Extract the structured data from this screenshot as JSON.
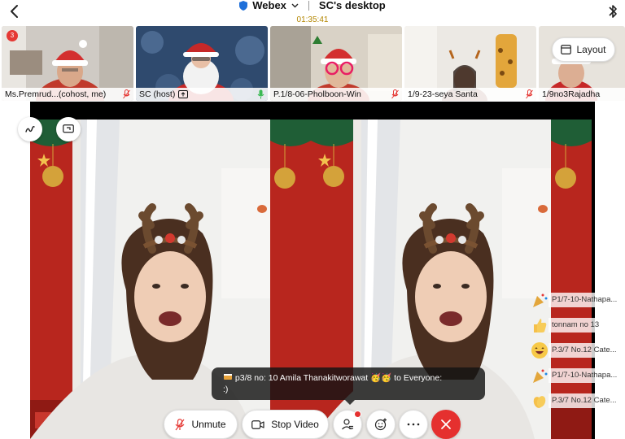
{
  "header": {
    "app_name": "Webex",
    "meeting_title": "SC's desktop",
    "timer": "01:35:41"
  },
  "participants": [
    {
      "name": "Ms.Premrud...(cohost, me)",
      "mic": "muted",
      "badge": "3"
    },
    {
      "name": "SC (host)",
      "mic": "active",
      "sharing": true
    },
    {
      "name": "P.1/8-06-Pholboon-Win",
      "mic": "muted"
    },
    {
      "name": "1/9-23-seya Santa",
      "mic": "muted"
    },
    {
      "name": "1/9no3Rajadha",
      "mic": "none"
    }
  ],
  "layout_button": {
    "label": "Layout",
    "icon": "layout-icon"
  },
  "reactions": [
    {
      "emoji": "party-popper-icon",
      "text": "P1/7-10-Nathapa..."
    },
    {
      "emoji": "thumbs-up-icon",
      "text": "tonnam no 13"
    },
    {
      "emoji": "laughing-face-icon",
      "text": "P.3/7 No.12 Cate..."
    },
    {
      "emoji": "party-popper-icon",
      "text": "P1/7-10-Nathapa..."
    },
    {
      "emoji": "clapping-hands-icon",
      "text": "P.3/7 No.12 Cate..."
    }
  ],
  "chat_toast": {
    "icon": "chat-emoji-icon",
    "sender_line": "p3/8 no: 10 Amila Thanakitworawat",
    "emojis": "🥳🥳",
    "recipient": "to Everyone:",
    "message": ":)"
  },
  "controls": {
    "unmute_label": "Unmute",
    "stop_video_label": "Stop Video",
    "participants_icon": "participants-icon",
    "reactions_icon": "reactions-icon",
    "more_icon": "more-icon",
    "end_icon": "close-icon"
  },
  "colors": {
    "accent_yellow": "#b38600",
    "end_red": "#e5302f",
    "mic_active": "#3cba54",
    "mic_muted": "#e53935",
    "christmas_red": "#b8261e"
  }
}
